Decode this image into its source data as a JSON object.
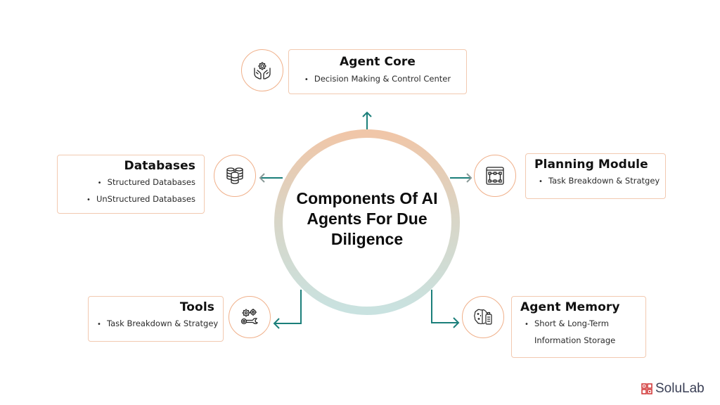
{
  "center": {
    "title": "Components Of AI Agents For Due Diligence",
    "title_lines": [
      "Components Of AI",
      "Agents For Due",
      "Diligence"
    ]
  },
  "colors": {
    "ring_top": "#f0c6a8",
    "ring_bottom": "#c9e2e0",
    "connector": "#1b7f7a",
    "arrowhead_side": "#8a9a98",
    "card_border": "#f2c9b0",
    "icon_border": "#f0b08a",
    "logo_red": "#d23b3b",
    "logo_text": "#3a3f55"
  },
  "components": {
    "agent_core": {
      "title": "Agent Core",
      "icon": "hands-gear-icon",
      "items": [
        "Decision Making & Control Center"
      ]
    },
    "databases": {
      "title": "Databases",
      "icon": "database-stack-icon",
      "items": [
        "Structured Databases",
        "UnStructured Databases"
      ]
    },
    "planning_module": {
      "title": "Planning Module",
      "icon": "workflow-board-icon",
      "items": [
        "Task Breakdown & Stratgey"
      ]
    },
    "tools": {
      "title": "Tools",
      "icon": "gears-wrench-icon",
      "items": [
        "Task Breakdown & Stratgey"
      ]
    },
    "agent_memory": {
      "title": "Agent Memory",
      "icon": "brain-storage-icon",
      "items": [
        "Short & Long-Term",
        "Information Storage"
      ]
    }
  },
  "bullet": "•",
  "logo": {
    "text": "SoluLab"
  }
}
